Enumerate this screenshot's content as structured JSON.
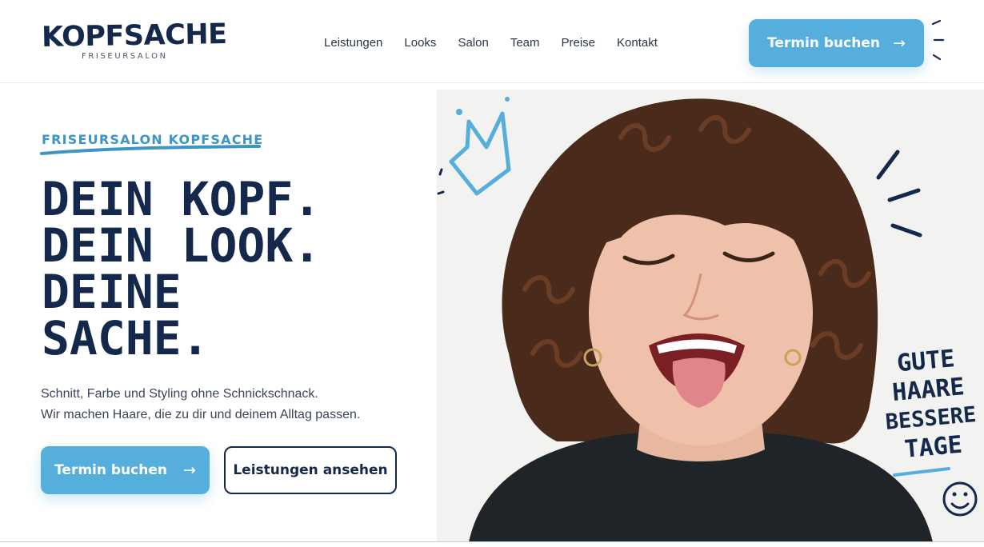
{
  "header": {
    "logo_name": "KOPFSACHE",
    "logo_sub": "FRISEURSALON",
    "nav": [
      "Leistungen",
      "Looks",
      "Salon",
      "Team",
      "Preise",
      "Kontakt"
    ],
    "cta_label": "Termin buchen",
    "cta_arrow": "→"
  },
  "hero": {
    "eyebrow": "FRISEURSALON KOPFSACHE",
    "headline": [
      "DEIN KOPF.",
      "DEIN LOOK.",
      "DEINE",
      "SACHE."
    ],
    "subtext": [
      "Schnitt, Farbe und Styling ohne Schnickschnack.",
      "Wir machen Haare, die zu dir und deinem Alltag passen."
    ],
    "primary_button": "Termin buchen",
    "primary_arrow": "→",
    "secondary_button": "Leistungen ansehen"
  },
  "image": {
    "handwritten_text": [
      "GUTE",
      "HAARE",
      "BESSERE",
      "TAGE"
    ],
    "icons": [
      "crown-icon",
      "smiley-icon"
    ]
  },
  "colors": {
    "navy": "#13284b",
    "accent_blue": "#55aedb",
    "eyebrow_blue": "#3c95c4"
  }
}
